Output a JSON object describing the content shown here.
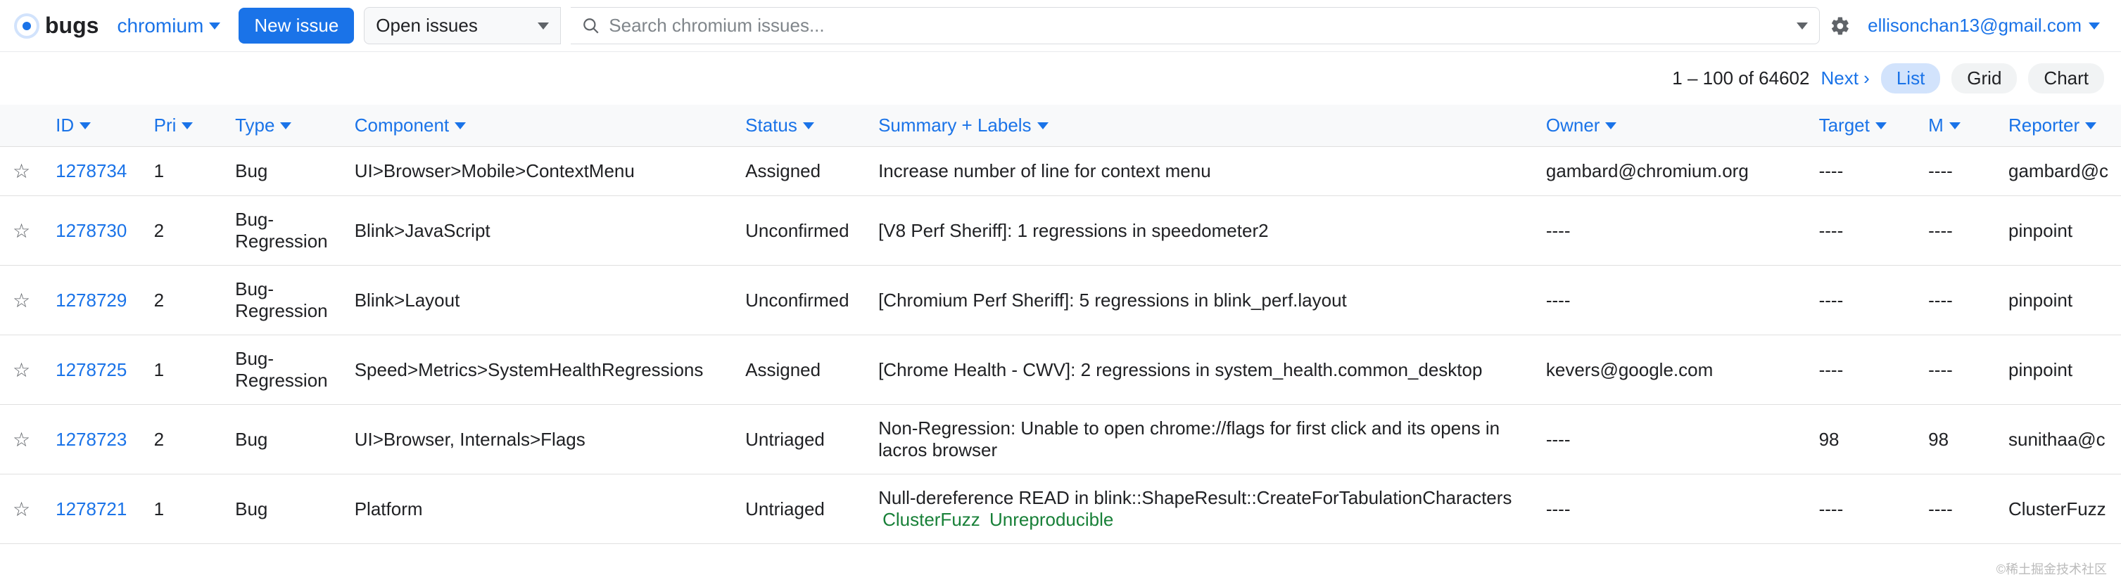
{
  "header": {
    "logo_text": "bugs",
    "project": "chromium",
    "new_issue_label": "New issue",
    "filter_label": "Open issues",
    "search_placeholder": "Search chromium issues...",
    "user_email": "ellisonchan13@gmail.com"
  },
  "toolbar": {
    "range_text": "1 – 100 of 64602",
    "next_label": "Next ›",
    "views": {
      "list": "List",
      "grid": "Grid",
      "chart": "Chart"
    }
  },
  "columns": {
    "id": "ID",
    "pri": "Pri",
    "type": "Type",
    "component": "Component",
    "status": "Status",
    "summary": "Summary + Labels",
    "owner": "Owner",
    "target": "Target",
    "m": "M",
    "reporter": "Reporter"
  },
  "rows": [
    {
      "id": "1278734",
      "pri": "1",
      "type": "Bug",
      "component": "UI>Browser>Mobile>ContextMenu",
      "status": "Assigned",
      "summary": "Increase number of line for context menu",
      "labels": [],
      "owner": "gambard@chromium.org",
      "target": "----",
      "m": "----",
      "reporter": "gambard@c"
    },
    {
      "id": "1278730",
      "pri": "2",
      "type": "Bug-Regression",
      "component": "Blink>JavaScript",
      "status": "Unconfirmed",
      "summary": "[V8 Perf Sheriff]: 1 regressions in speedometer2",
      "labels": [],
      "owner": "----",
      "target": "----",
      "m": "----",
      "reporter": "pinpoint"
    },
    {
      "id": "1278729",
      "pri": "2",
      "type": "Bug-Regression",
      "component": "Blink>Layout",
      "status": "Unconfirmed",
      "summary": "[Chromium Perf Sheriff]: 5 regressions in blink_perf.layout",
      "labels": [],
      "owner": "----",
      "target": "----",
      "m": "----",
      "reporter": "pinpoint"
    },
    {
      "id": "1278725",
      "pri": "1",
      "type": "Bug-Regression",
      "component": "Speed>Metrics>SystemHealthRegressions",
      "status": "Assigned",
      "summary": "[Chrome Health - CWV]: 2 regressions in system_health.common_desktop",
      "labels": [],
      "owner": "kevers@google.com",
      "target": "----",
      "m": "----",
      "reporter": "pinpoint"
    },
    {
      "id": "1278723",
      "pri": "2",
      "type": "Bug",
      "component": "UI>Browser, Internals>Flags",
      "status": "Untriaged",
      "summary": "Non-Regression: Unable to open chrome://flags for first click and its opens in lacros browser",
      "labels": [],
      "owner": "----",
      "target": "98",
      "m": "98",
      "reporter": "sunithaa@c"
    },
    {
      "id": "1278721",
      "pri": "1",
      "type": "Bug",
      "component": "Platform",
      "status": "Untriaged",
      "summary": "Null-dereference READ in blink::ShapeResult::CreateForTabulationCharacters",
      "labels": [
        "ClusterFuzz",
        "Unreproducible"
      ],
      "owner": "----",
      "target": "----",
      "m": "----",
      "reporter": "ClusterFuzz"
    }
  ],
  "watermark": "©稀土掘金技术社区"
}
